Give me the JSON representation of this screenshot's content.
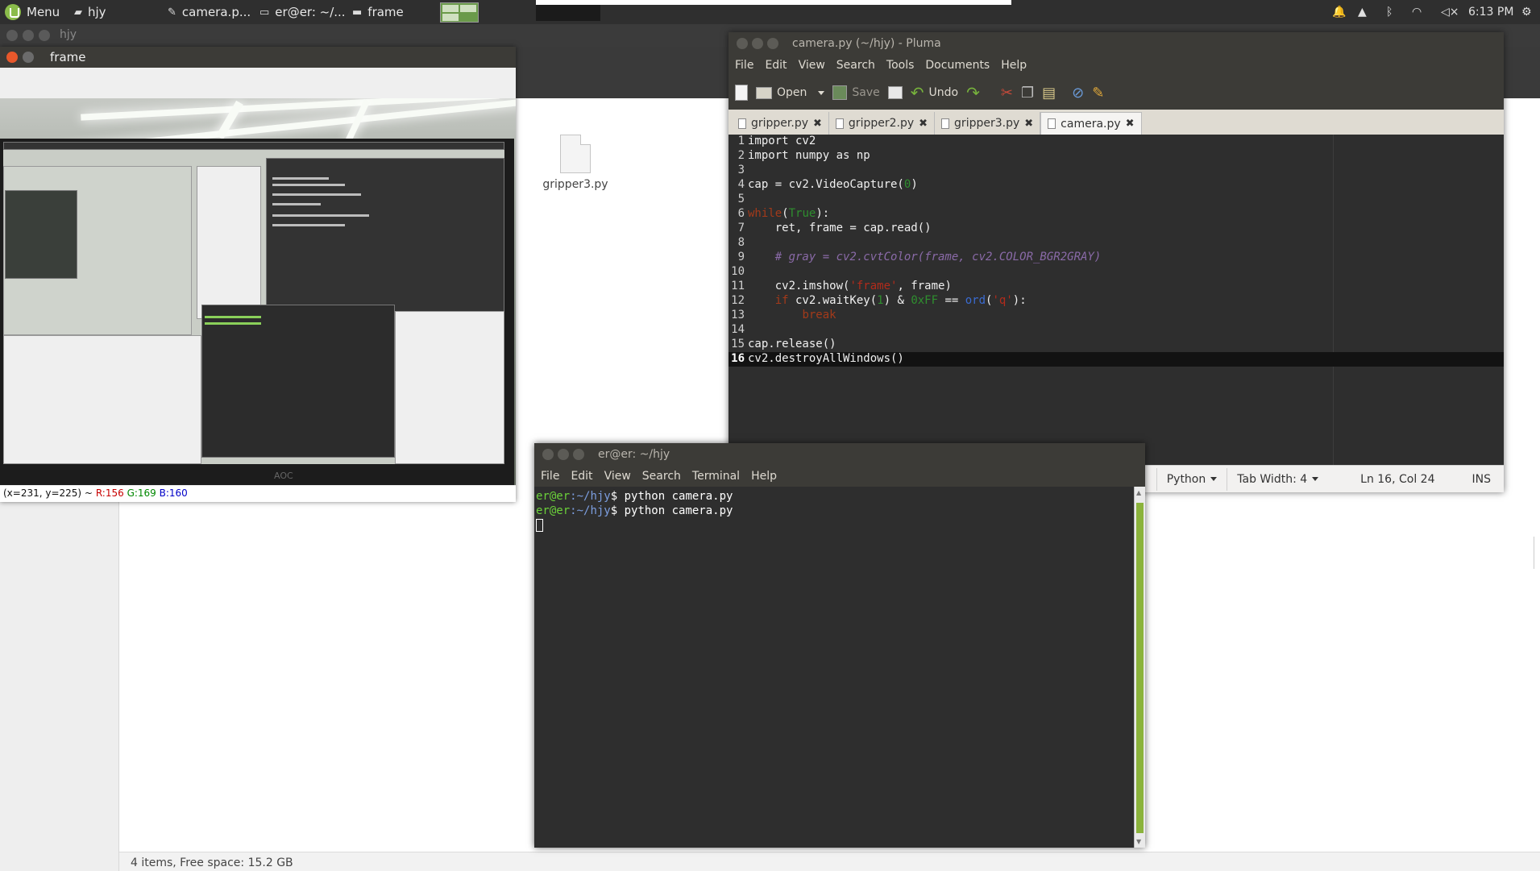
{
  "panel": {
    "menu_label": "Menu",
    "tasks": [
      "hjy",
      "camera.p...",
      "er@er: ~/...",
      "frame"
    ],
    "clock": "6:13 PM"
  },
  "file_manager": {
    "title": "hjy",
    "file_name": "gripper3.py",
    "status": "4 items, Free space: 15.2 GB"
  },
  "frame_window": {
    "title": "frame",
    "status_coords": "(x=231, y=225) ~",
    "status_r": "R:156",
    "status_g": "G:169",
    "status_b": "B:160",
    "monitor_logo": "AOC"
  },
  "pluma": {
    "title": "camera.py (~/hjy) - Pluma",
    "menu": [
      "File",
      "Edit",
      "View",
      "Search",
      "Tools",
      "Documents",
      "Help"
    ],
    "toolbar": {
      "open": "Open",
      "save": "Save",
      "undo": "Undo"
    },
    "tabs": [
      "gripper.py",
      "gripper2.py",
      "gripper3.py",
      "camera.py"
    ],
    "active_tab": "camera.py",
    "code_lines": [
      "import cv2",
      "import numpy as np",
      "",
      "cap = cv2.VideoCapture(0)",
      "",
      "while(True):",
      "    ret, frame = cap.read()",
      "",
      "    # gray = cv2.cvtColor(frame, cv2.COLOR_BGR2GRAY)",
      "",
      "    cv2.imshow('frame', frame)",
      "    if cv2.waitKey(1) & 0xFF == ord('q'):",
      "        break",
      "",
      "cap.release()",
      "cv2.destroyAllWindows()"
    ],
    "current_line": 16,
    "status": {
      "language": "Python",
      "tab_width": "Tab Width: 4",
      "position": "Ln 16, Col 24",
      "mode": "INS"
    }
  },
  "terminal": {
    "title": "er@er: ~/hjy",
    "menu": [
      "File",
      "Edit",
      "View",
      "Search",
      "Terminal",
      "Help"
    ],
    "prompt_user": "er@er",
    "prompt_path": ":~/hjy",
    "prompt_symbol": "$ ",
    "lines": [
      "python camera.py",
      "python camera.py"
    ]
  },
  "colors": {
    "panel_bg": "#2f2f2f",
    "titlebar_bg": "#3c3b37",
    "editor_bg": "#2e2e2e",
    "accent_green": "#8bb33c"
  }
}
